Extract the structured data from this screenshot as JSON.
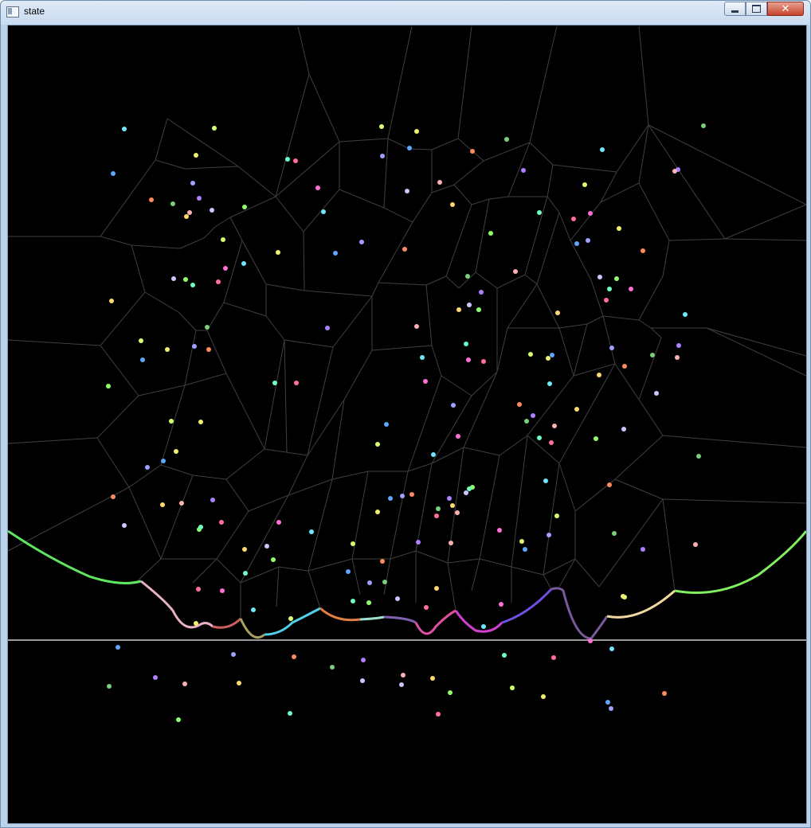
{
  "window": {
    "title": "state",
    "controls": {
      "minimize": "minimize",
      "maximize": "maximize",
      "close": "close"
    }
  },
  "colors": {
    "background": "#000000",
    "edge": "#3f3f3f",
    "sweep_line": "#9a9a9a",
    "beach_line_start": "#5fe85f"
  }
}
